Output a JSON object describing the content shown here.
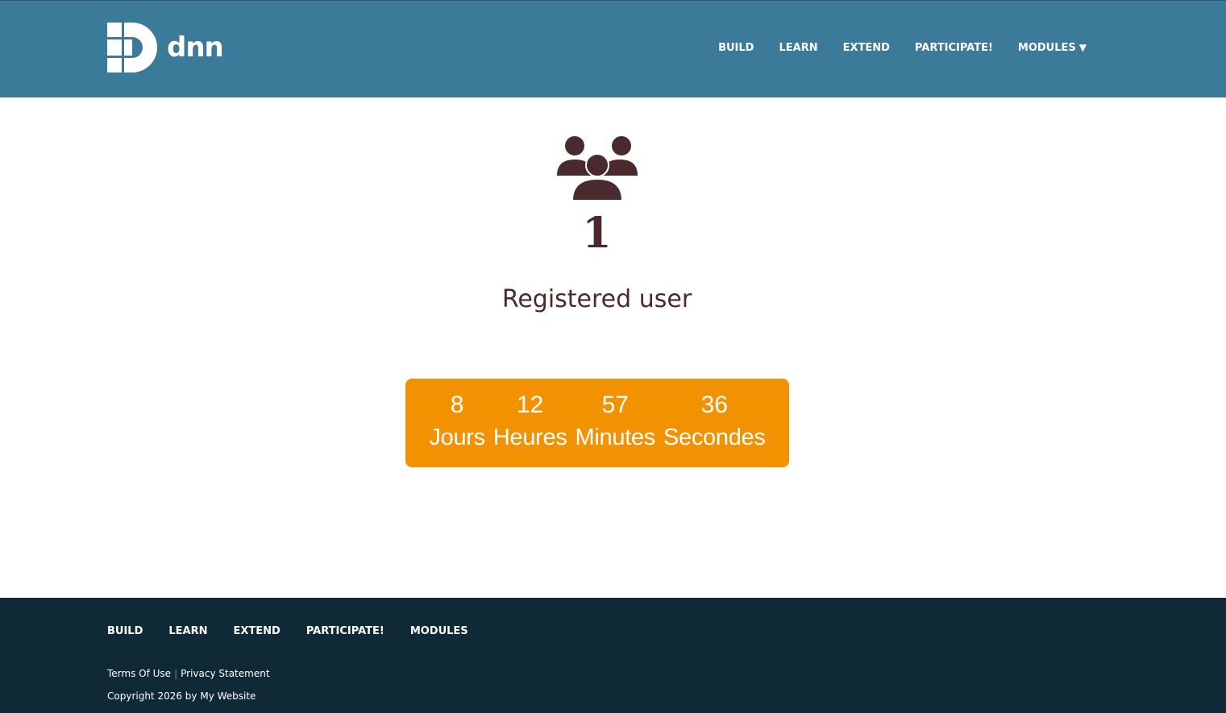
{
  "brand": {
    "name": "dnn"
  },
  "nav": {
    "items": [
      "BUILD",
      "LEARN",
      "EXTEND",
      "PARTICIPATE!"
    ],
    "dropdown_label": "MODULES",
    "dropdown_caret": "▼"
  },
  "stats": {
    "icon": "users-icon",
    "count": "1",
    "label": "Registered user"
  },
  "countdown": {
    "background": "#f39200",
    "units": [
      {
        "value": "8",
        "label": "Jours"
      },
      {
        "value": "12",
        "label": "Heures"
      },
      {
        "value": "57",
        "label": "Minutes"
      },
      {
        "value": "36",
        "label": "Secondes"
      }
    ]
  },
  "footer": {
    "nav": [
      "BUILD",
      "LEARN",
      "EXTEND",
      "PARTICIPATE!",
      "MODULES"
    ],
    "terms": "Terms Of Use",
    "separator": "|",
    "privacy": "Privacy Statement",
    "copyright": "Copyright 2026 by My Website"
  },
  "colors": {
    "header": "#3b7a98",
    "footer": "#0f2937",
    "text_dark": "#4a2a2c",
    "accent": "#f39200"
  }
}
